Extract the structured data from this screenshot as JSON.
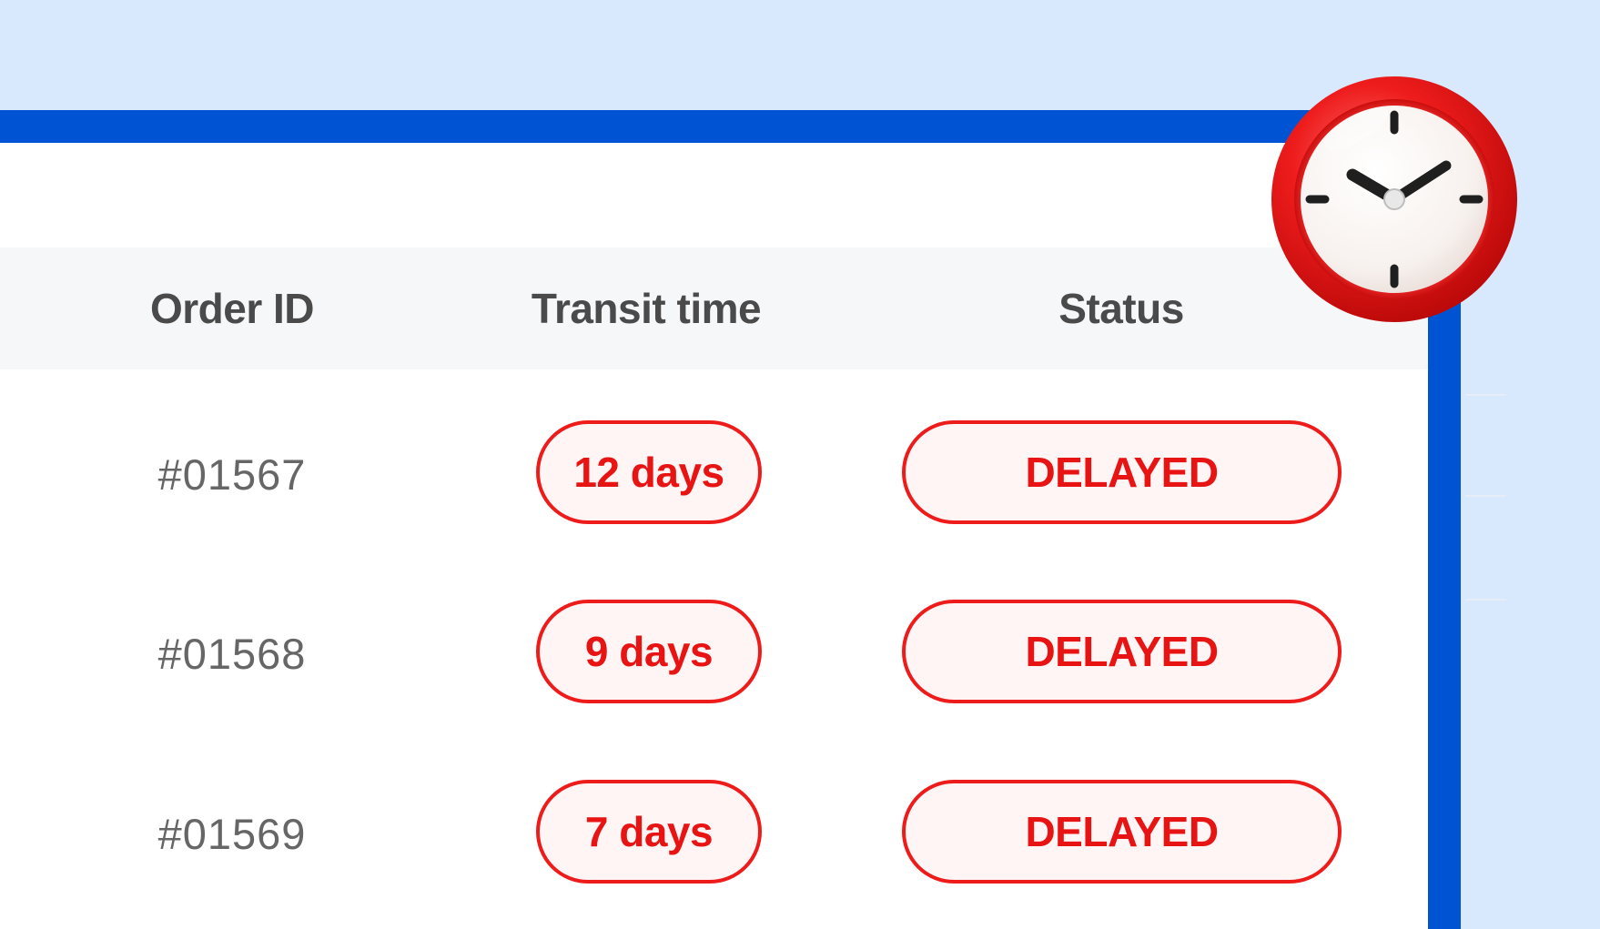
{
  "table": {
    "columns": [
      "Order ID",
      "Transit time",
      "Status"
    ],
    "rows": [
      {
        "order_id": "#01567",
        "transit_time": "12 days",
        "status": "DELAYED"
      },
      {
        "order_id": "#01568",
        "transit_time": "9 days",
        "status": "DELAYED"
      },
      {
        "order_id": "#01569",
        "transit_time": "7 days",
        "status": "DELAYED"
      }
    ]
  },
  "colors": {
    "background": "#d8e9fd",
    "window_frame": "#0054d4",
    "delay_red": "#e81414",
    "pill_fill": "#fff5f5",
    "header_bg": "#f6f7f9"
  },
  "icons": {
    "clock": "alarm-clock-icon"
  }
}
